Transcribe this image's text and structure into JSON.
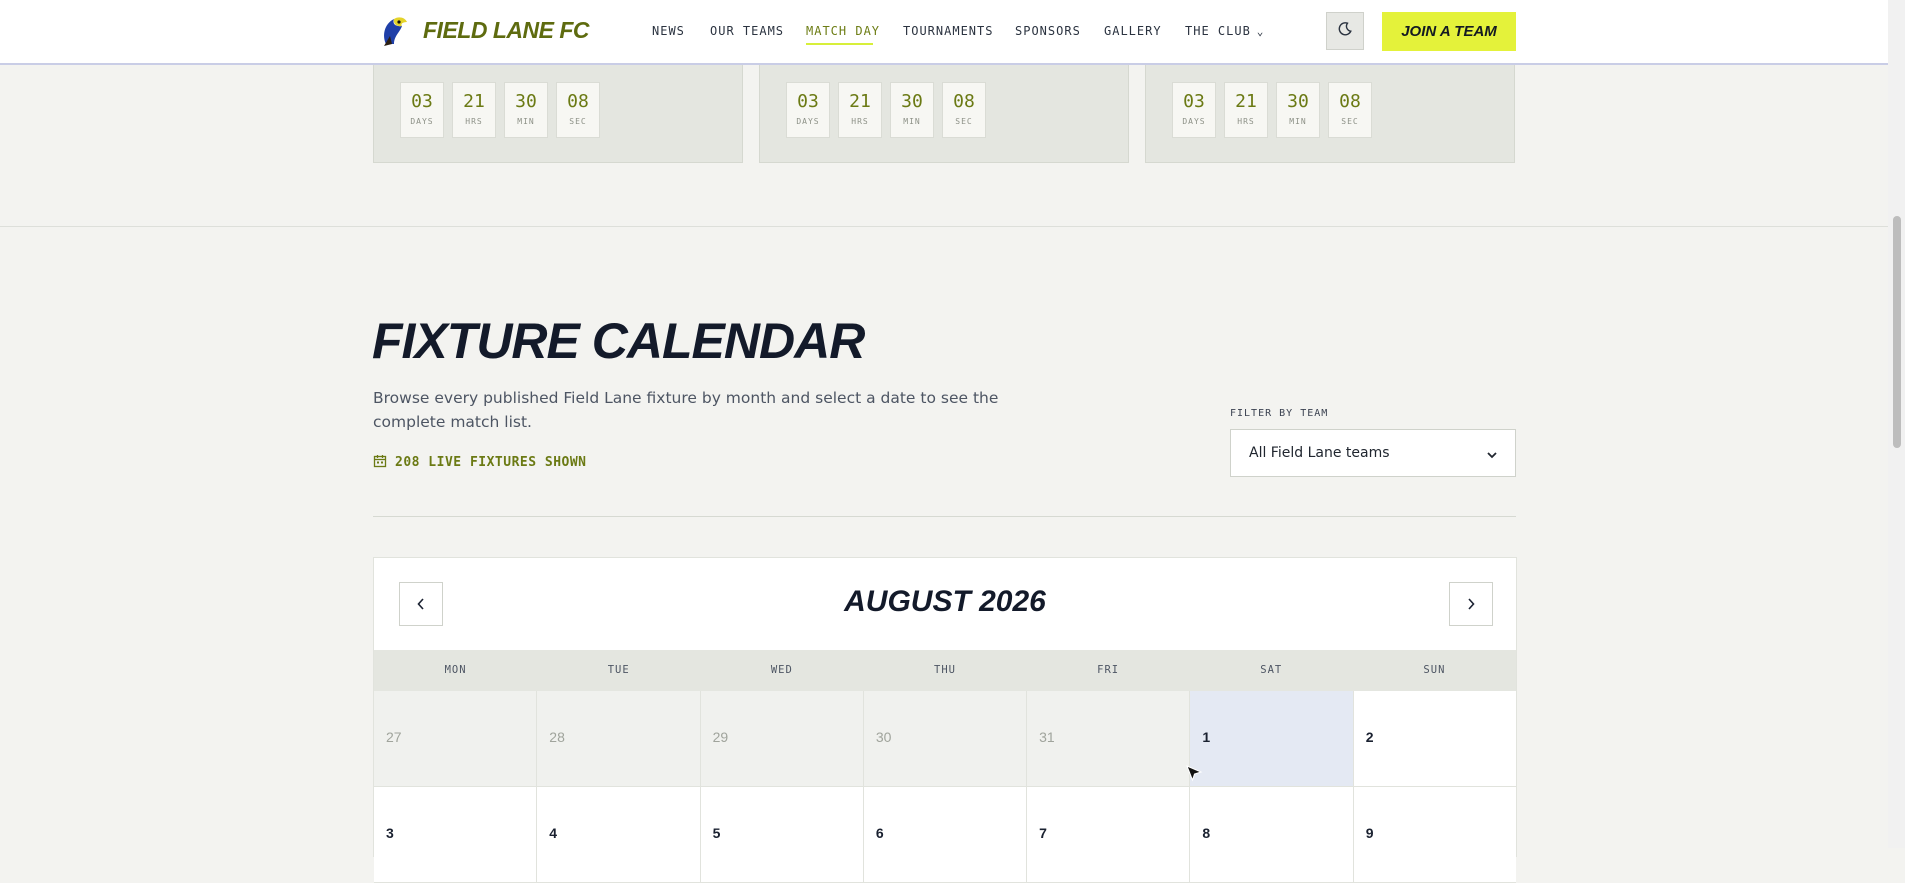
{
  "header": {
    "logo_text": "FIELD LANE FC",
    "nav": [
      {
        "label": "NEWS",
        "active": false
      },
      {
        "label": "OUR TEAMS",
        "active": false
      },
      {
        "label": "MATCH DAY",
        "active": true
      },
      {
        "label": "TOURNAMENTS",
        "active": false
      },
      {
        "label": "SPONSORS",
        "active": false
      },
      {
        "label": "GALLERY",
        "active": false
      },
      {
        "label": "THE CLUB",
        "active": false
      }
    ],
    "theme_toggle_icon": "moon-icon",
    "join_label": "JOIN A TEAM",
    "accent": "#e4f23a",
    "brand": "#5e6b0f"
  },
  "countdowns": [
    {
      "days": "03",
      "hrs": "21",
      "min": "30",
      "sec": "08"
    },
    {
      "days": "03",
      "hrs": "21",
      "min": "30",
      "sec": "08"
    },
    {
      "days": "03",
      "hrs": "21",
      "min": "30",
      "sec": "08"
    }
  ],
  "countdown_units": {
    "days": "DAYS",
    "hrs": "HRS",
    "min": "MIN",
    "sec": "SEC"
  },
  "fixtures": {
    "title": "FIXTURE CALENDAR",
    "description": "Browse every published Field Lane fixture by month and select a date to see the complete match list.",
    "live_count": "208 LIVE FIXTURES SHOWN",
    "filter_label": "FILTER BY TEAM",
    "filter_value": "All Field Lane teams"
  },
  "calendar": {
    "month_label": "AUGUST 2026",
    "weekdays": [
      "MON",
      "TUE",
      "WED",
      "THU",
      "FRI",
      "SAT",
      "SUN"
    ],
    "rows": [
      [
        {
          "day": "27",
          "muted": true
        },
        {
          "day": "28",
          "muted": true
        },
        {
          "day": "29",
          "muted": true
        },
        {
          "day": "30",
          "muted": true
        },
        {
          "day": "31",
          "muted": true
        },
        {
          "day": "1",
          "muted": false,
          "selected": true
        },
        {
          "day": "2",
          "muted": false
        }
      ],
      [
        {
          "day": "3",
          "muted": false
        },
        {
          "day": "4",
          "muted": false
        },
        {
          "day": "5",
          "muted": false
        },
        {
          "day": "6",
          "muted": false
        },
        {
          "day": "7",
          "muted": false
        },
        {
          "day": "8",
          "muted": false
        },
        {
          "day": "9",
          "muted": false
        }
      ]
    ]
  }
}
